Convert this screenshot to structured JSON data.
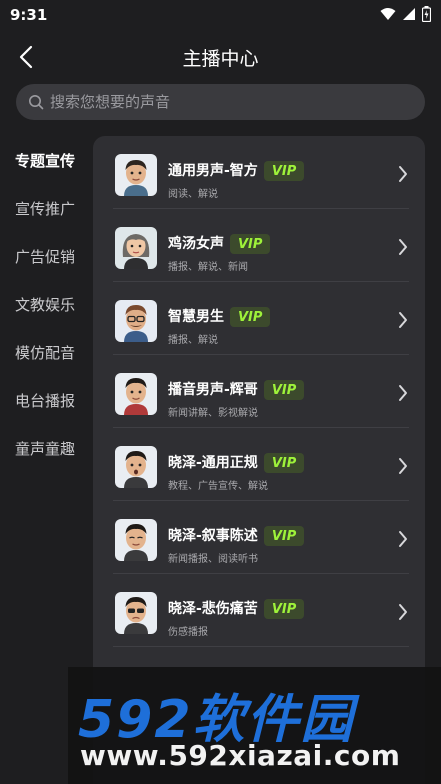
{
  "status": {
    "time": "9:31"
  },
  "header": {
    "title": "主播中心"
  },
  "search": {
    "placeholder": "搜索您想要的声音"
  },
  "sidebar": {
    "items": [
      {
        "label": "专题宣传",
        "active": true
      },
      {
        "label": "宣传推广"
      },
      {
        "label": "广告促销"
      },
      {
        "label": "文教娱乐"
      },
      {
        "label": "模仿配音"
      },
      {
        "label": "电台播报"
      },
      {
        "label": "童声童趣"
      }
    ]
  },
  "voices": [
    {
      "name": "通用男声-智方",
      "badge": "VIP",
      "tags": "阅读、解说",
      "icon": "avatar-man-icon"
    },
    {
      "name": "鸡汤女声",
      "badge": "VIP",
      "tags": "播报、解说、新闻",
      "icon": "avatar-woman-icon"
    },
    {
      "name": "智慧男生",
      "badge": "VIP",
      "tags": "播报、解说",
      "icon": "avatar-man-glasses-icon"
    },
    {
      "name": "播音男声-辉哥",
      "badge": "VIP",
      "tags": "新闻讲解、影视解说",
      "icon": "avatar-man-icon"
    },
    {
      "name": "晓泽-通用正规",
      "badge": "VIP",
      "tags": "教程、广告宣传、解说",
      "icon": "avatar-man-icon"
    },
    {
      "name": "晓泽-叙事陈述",
      "badge": "VIP",
      "tags": "新闻播报、阅读听书",
      "icon": "avatar-man-icon"
    },
    {
      "name": "晓泽-悲伤痛苦",
      "badge": "VIP",
      "tags": "伤感播报",
      "icon": "avatar-man-icon"
    }
  ],
  "watermark": {
    "logo": "592软件园",
    "url": "www.592xiazai.com"
  },
  "colors": {
    "accent": "#9ef23a",
    "vip_bg": "#3c4a2c",
    "panel": "#2f2f33",
    "background": "#1e1e20"
  }
}
